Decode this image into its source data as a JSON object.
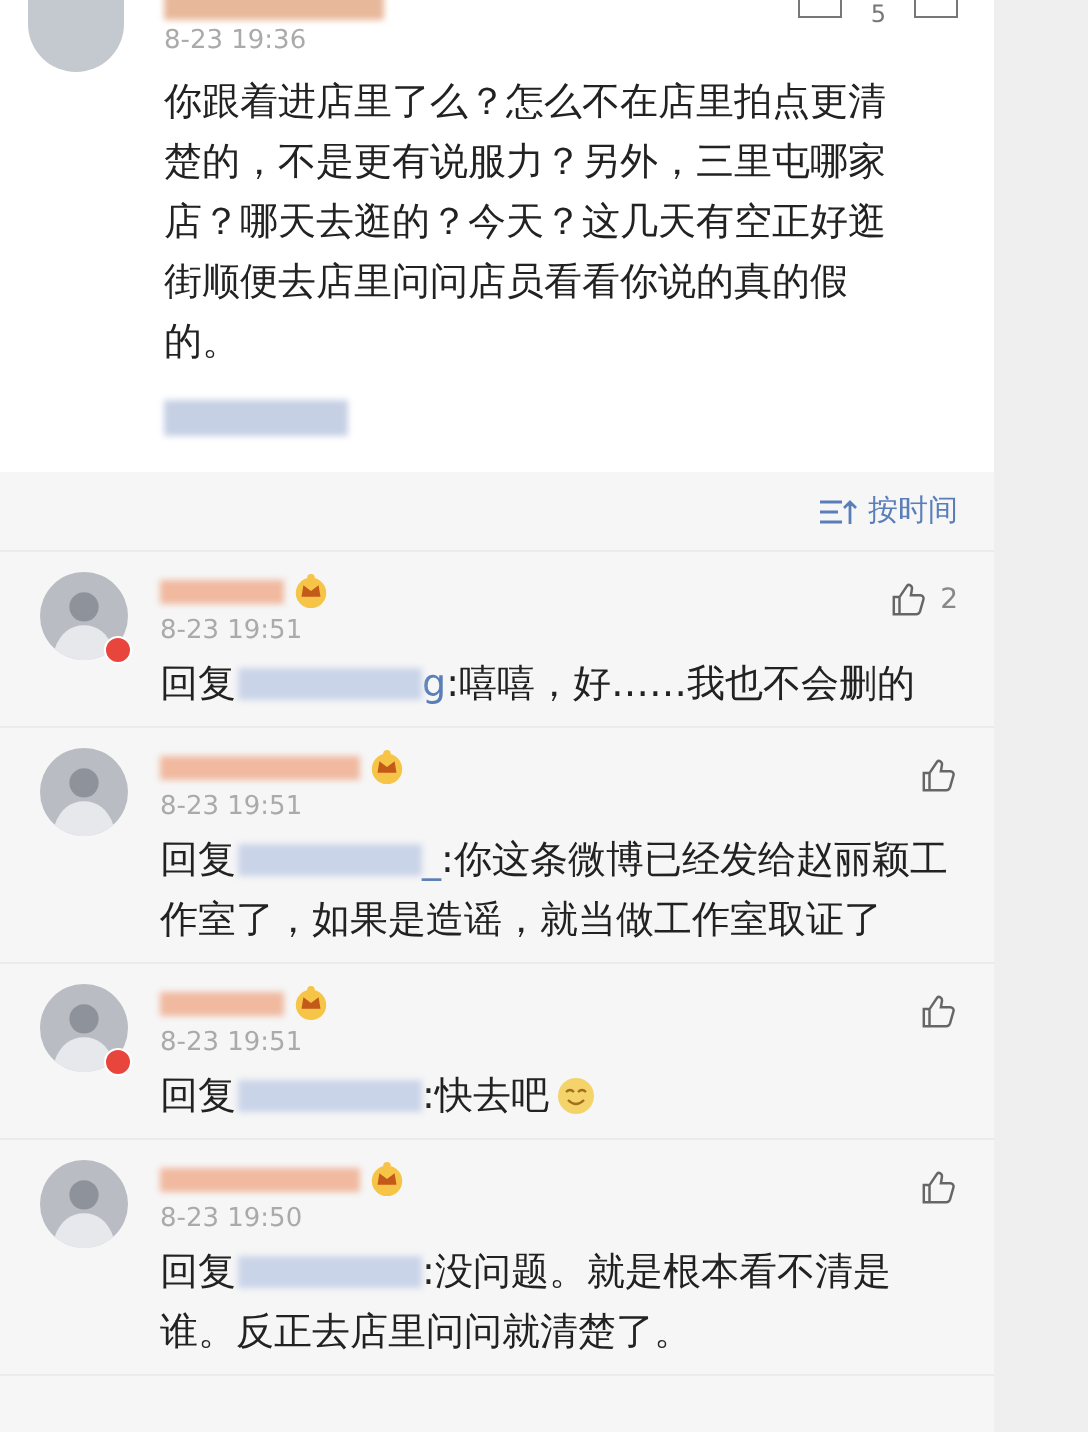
{
  "top_comment": {
    "time": "8-23 19:36",
    "likes": "5",
    "text": "你跟着进店里了么？怎么不在店里拍点更清楚的，不是更有说服力？另外，三里屯哪家店？哪天去逛的？今天？这几天有空正好逛街顺便去店里问问店员看看你说的真的假的。"
  },
  "sort": {
    "label": "按时间"
  },
  "replies": [
    {
      "time": "8-23 19:51",
      "likes": "2",
      "avatar_badge": true,
      "reply_prefix": "回复",
      "mention_tail": "g",
      "text": ":嘻嘻，好……我也不会删的",
      "emoji": false
    },
    {
      "time": "8-23 19:51",
      "avatar_badge": false,
      "reply_prefix": "回复",
      "mention_tail": "_",
      "text": ":你这条微博已经发给赵丽颖工作室了，如果是造谣，就当做工作室取证了",
      "emoji": false
    },
    {
      "time": "8-23 19:51",
      "avatar_badge": true,
      "reply_prefix": "回复",
      "text": ":快去吧",
      "emoji": true
    },
    {
      "time": "8-23 19:50",
      "avatar_badge": false,
      "reply_prefix": "回复",
      "text": ":没问题。就是根本看不清是谁。反正去店里问问就清楚了。",
      "emoji": false
    }
  ]
}
